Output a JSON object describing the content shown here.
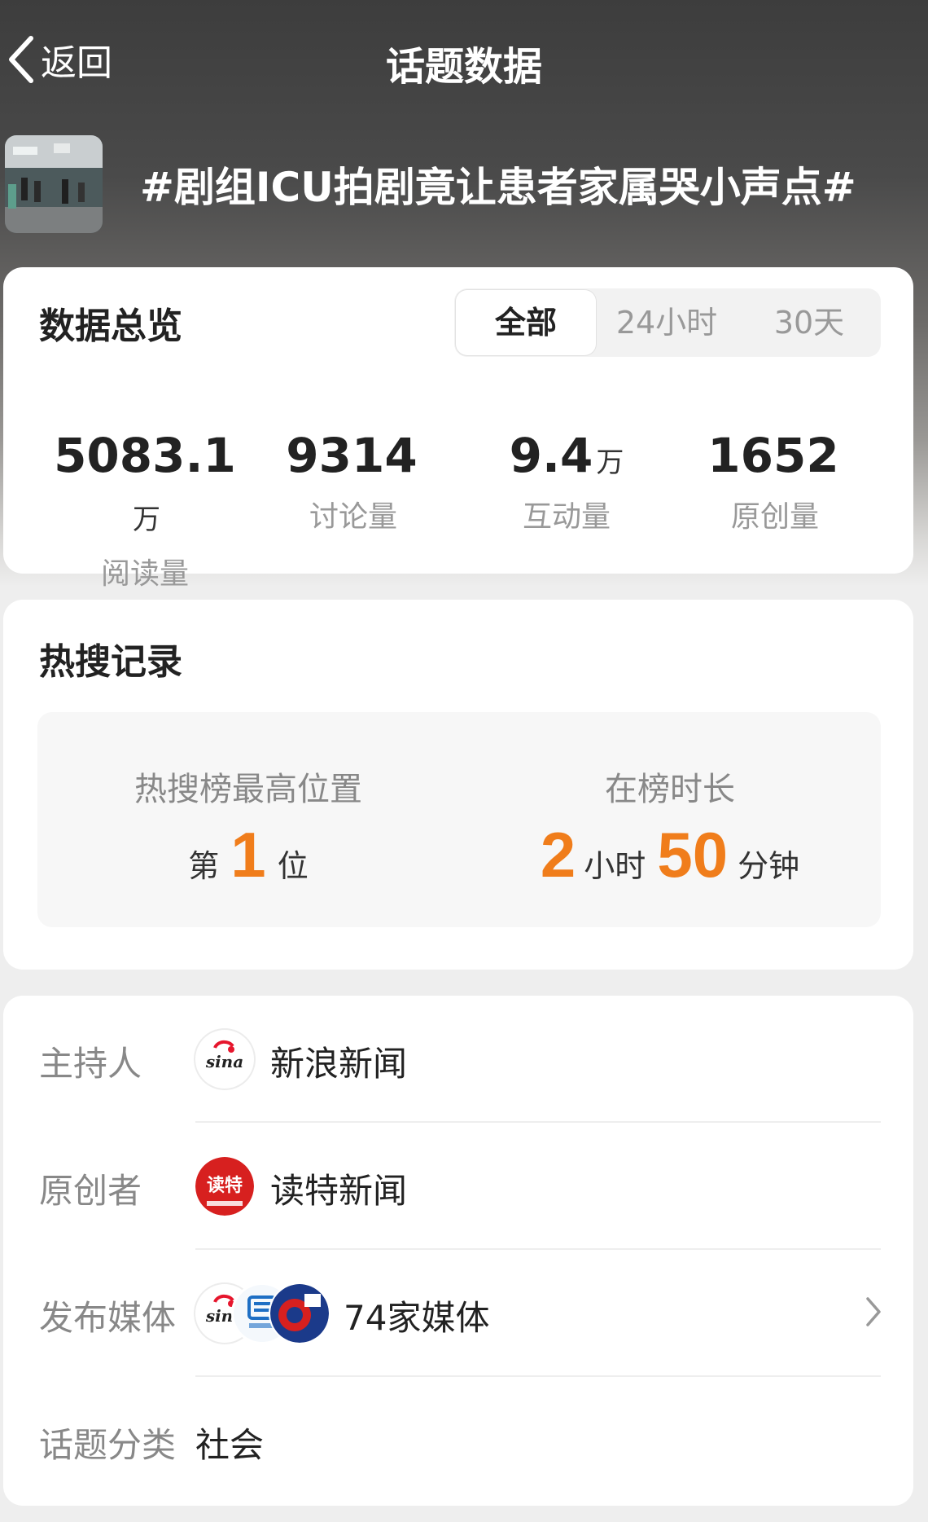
{
  "nav": {
    "back_label": "返回",
    "title": "话题数据"
  },
  "topic": {
    "title": "#剧组ICU拍剧竟让患者家属哭小声点#"
  },
  "overview": {
    "title": "数据总览",
    "tabs": [
      {
        "label": "全部",
        "active": true
      },
      {
        "label": "24小时",
        "active": false
      },
      {
        "label": "30天",
        "active": false
      }
    ],
    "stats": [
      {
        "value": "5083.1",
        "unit": "万",
        "label": "阅读量"
      },
      {
        "value": "9314",
        "unit": "",
        "label": "讨论量"
      },
      {
        "value": "9.4",
        "unit": "万",
        "label": "互动量"
      },
      {
        "value": "1652",
        "unit": "",
        "label": "原创量"
      }
    ]
  },
  "hot": {
    "title": "热搜记录",
    "peak": {
      "label": "热搜榜最高位置",
      "prefix": "第",
      "value": "1",
      "suffix": "位"
    },
    "duration": {
      "label": "在榜时长",
      "hours": "2",
      "hours_unit": "小时",
      "minutes": "50",
      "minutes_unit": "分钟"
    }
  },
  "info": {
    "host": {
      "label": "主持人",
      "name": "新浪新闻",
      "avatar_text": "sina"
    },
    "creator": {
      "label": "原创者",
      "name": "读特新闻",
      "avatar_text": "读特"
    },
    "media": {
      "label": "发布媒体",
      "count_text": "74家媒体"
    },
    "category": {
      "label": "话题分类",
      "value": "社会"
    }
  },
  "colors": {
    "accent": "#f07d1b",
    "sina_red": "#e6162d",
    "dute_red": "#d7201f"
  }
}
